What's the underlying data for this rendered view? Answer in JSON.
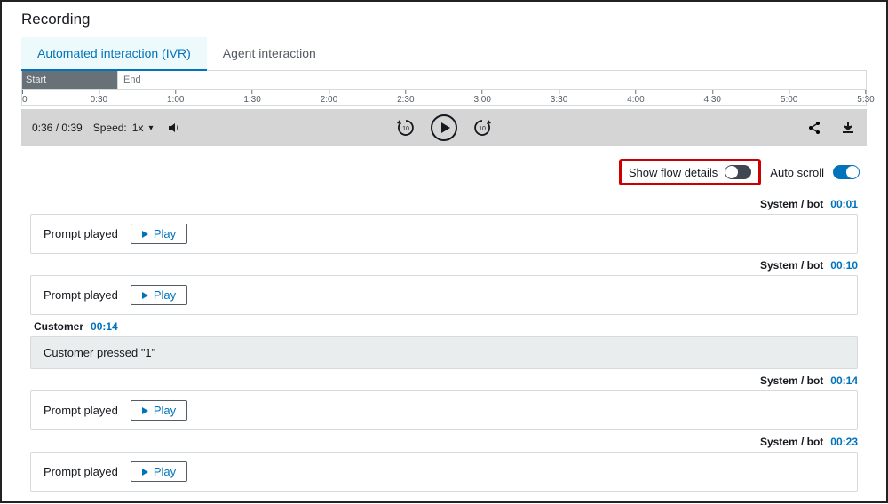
{
  "title": "Recording",
  "tabs": {
    "ivr": "Automated interaction (IVR)",
    "agent": "Agent interaction"
  },
  "timeline": {
    "start_label": "Start",
    "end_label": "End",
    "ticks": [
      "0",
      "0:30",
      "1:00",
      "1:30",
      "2:00",
      "2:30",
      "3:00",
      "3:30",
      "4:00",
      "4:30",
      "5:00",
      "5:30"
    ]
  },
  "player": {
    "time": "0:36 / 0:39",
    "speed_label": "Speed:",
    "speed_value": "1x",
    "skip_back": "10",
    "skip_fwd": "10"
  },
  "toggles": {
    "show_flow_label": "Show flow details",
    "auto_scroll_label": "Auto scroll"
  },
  "speakers": {
    "system": "System / bot",
    "customer": "Customer"
  },
  "labels": {
    "prompt_played": "Prompt played",
    "play": "Play"
  },
  "events": [
    {
      "kind": "system",
      "ts": "00:01",
      "type": "prompt"
    },
    {
      "kind": "system",
      "ts": "00:10",
      "type": "prompt"
    },
    {
      "kind": "customer",
      "ts": "00:14",
      "type": "input",
      "text": "Customer pressed \"1\""
    },
    {
      "kind": "system",
      "ts": "00:14",
      "type": "prompt"
    },
    {
      "kind": "system",
      "ts": "00:23",
      "type": "prompt"
    }
  ]
}
